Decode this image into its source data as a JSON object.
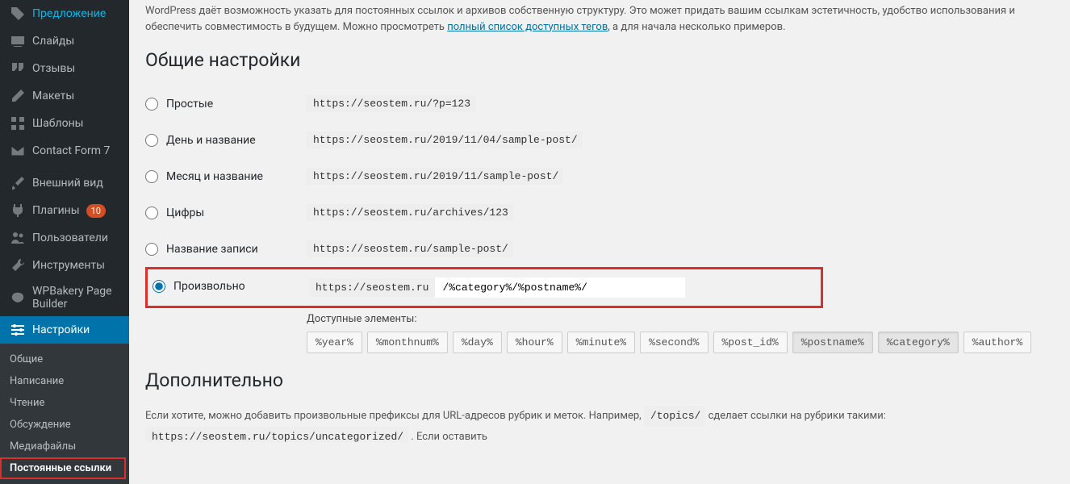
{
  "sidebar": {
    "items": [
      {
        "label": "Предложение"
      },
      {
        "label": "Слайды"
      },
      {
        "label": "Отзывы"
      },
      {
        "label": "Макеты"
      },
      {
        "label": "Шаблоны"
      },
      {
        "label": "Contact Form 7"
      },
      {
        "label": "Внешний вид"
      },
      {
        "label": "Плагины",
        "badge": "10"
      },
      {
        "label": "Пользователи"
      },
      {
        "label": "Инструменты"
      },
      {
        "label": "WPBakery Page Builder"
      },
      {
        "label": "Настройки"
      }
    ],
    "sub": [
      {
        "label": "Общие"
      },
      {
        "label": "Написание"
      },
      {
        "label": "Чтение"
      },
      {
        "label": "Обсуждение"
      },
      {
        "label": "Медиафайлы"
      },
      {
        "label": "Постоянные ссылки",
        "current": true
      }
    ]
  },
  "intro": {
    "text1": "WordPress даёт возможность указать для постоянных ссылок и архивов собственную структуру. Это может придать вашим ссылкам эстетичность, удобство использования и обеспечить совместимость в будущем. Можно просмотреть ",
    "link": "полный список доступных тегов",
    "text2": ", а для начала несколько примеров."
  },
  "heading": "Общие настройки",
  "options": [
    {
      "label": "Простые",
      "code": "https://seostem.ru/?p=123"
    },
    {
      "label": "День и название",
      "code": "https://seostem.ru/2019/11/04/sample-post/"
    },
    {
      "label": "Месяц и название",
      "code": "https://seostem.ru/2019/11/sample-post/"
    },
    {
      "label": "Цифры",
      "code": "https://seostem.ru/archives/123"
    },
    {
      "label": "Название записи",
      "code": "https://seostem.ru/sample-post/"
    }
  ],
  "custom": {
    "label": "Произвольно",
    "prefix": "https://seostem.ru",
    "value": "/%category%/%postname%/"
  },
  "available": {
    "label": "Доступные элементы:",
    "tags": [
      "%year%",
      "%monthnum%",
      "%day%",
      "%hour%",
      "%minute%",
      "%second%",
      "%post_id%",
      "%postname%",
      "%category%",
      "%author%"
    ],
    "highlighted": [
      "%postname%",
      "%category%"
    ]
  },
  "heading2": "Дополнительно",
  "desc2": {
    "t1": "Если хотите, можно добавить произвольные префиксы для URL-адресов рубрик и меток. Например, ",
    "c1": "/topics/",
    "t2": " сделает ссылки на рубрики такими: ",
    "c2": "https://seostem.ru/topics/uncategorized/",
    "t3": " . Если оставить"
  }
}
